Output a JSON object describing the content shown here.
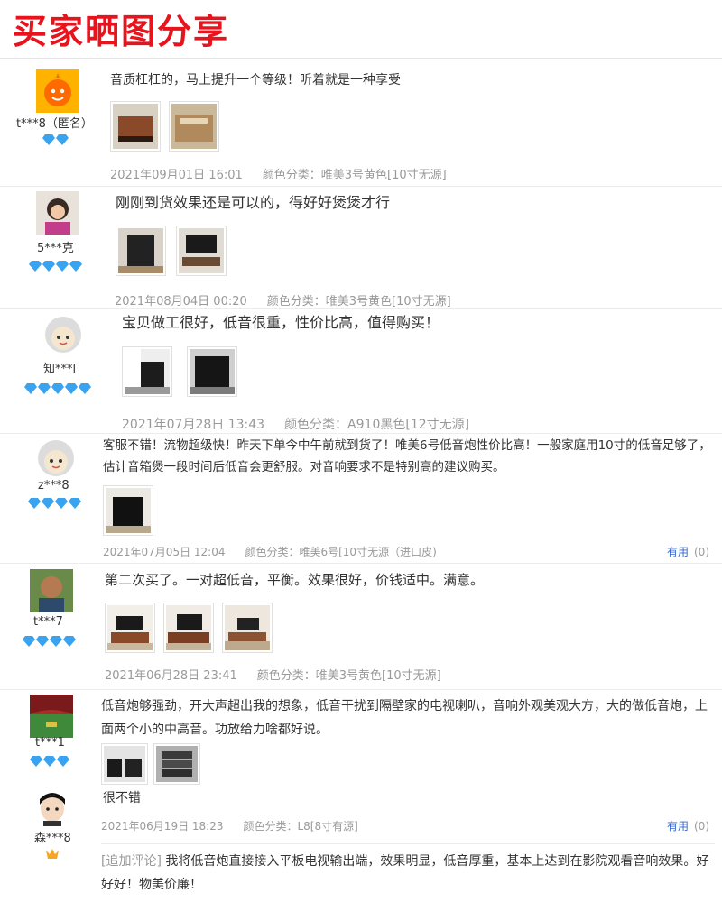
{
  "page_title": "买家晒图分享",
  "useful_label": "有用",
  "reviews": [
    {
      "user": "t***8（匿名）",
      "level": 2,
      "text": "音质杠杠的，马上提升一个等级！听着就是一种享受",
      "date": "2021年09月01日 16:01",
      "spec": "颜色分类：唯美3号黄色[10寸无源]",
      "avatar": "orange-cartoon",
      "images": [
        "brown-speaker-box",
        "packaged-box"
      ]
    },
    {
      "user": "5***克",
      "level": 4,
      "text": "刚刚到货效果还是可以的，得好好煲煲才行",
      "date": "2021年08月04日 00:20",
      "spec": "颜色分类：唯美3号黄色[10寸无源]",
      "avatar": "woman-photo",
      "images": [
        "speaker-on-floor",
        "tv-cabinet"
      ]
    },
    {
      "user": "知***l",
      "level": 5,
      "text": "宝贝做工很好，低音很重，性价比高，值得购买！",
      "date": "2021年07月28日 13:43",
      "spec": "颜色分类：A910黑色[12寸无源]",
      "avatar": "default-cartoon",
      "images": [
        "black-speaker-corner",
        "black-speaker-closeup"
      ]
    },
    {
      "user": "z***8",
      "level": 4,
      "text": "客服不错！流物超级快！昨天下单今中午前就到货了！唯美6号低音炮性价比高！一般家庭用10寸的低音足够了，估计音箱煲一段时间后低音会更舒服。对音响要求不是特别高的建议购买。",
      "date": "2021年07月05日 12:04",
      "spec": "颜色分类：唯美6号[10寸无源（进口皮)",
      "avatar": "default-cartoon",
      "images": [
        "black-speaker"
      ],
      "useful_count": "(0)"
    },
    {
      "user": "t***7",
      "level": 4,
      "text": "第二次买了。一对超低音，平衡。效果很好，价钱适中。满意。",
      "date": "2021年06月28日 23:41",
      "spec": "颜色分类：唯美3号黄色[10寸无源]",
      "avatar": "man-photo",
      "images": [
        "living-room-1",
        "living-room-2",
        "living-room-3"
      ]
    },
    {
      "user": "t***1",
      "level": 3,
      "text": "低音炮够强劲，开大声超出我的想象，低音干扰到隔壁家的电视喇叭，音响外观美观大方，大的做低音炮，上面两个小的中高音。功放给力啥都好说。",
      "date": "",
      "spec": "",
      "avatar": "stadium-photo",
      "images": [
        "speakers-small",
        "amplifier-stack"
      ]
    },
    {
      "user": "森***8",
      "level": 0,
      "crown": true,
      "text": "很不错",
      "date": "2021年06月19日 18:23",
      "spec": "颜色分类：L8[8寸有源]",
      "avatar": "boy-cartoon",
      "images": [],
      "useful_count": "(0)",
      "followup_tag": "[追加评论]",
      "followup_text": "我将低音炮直接接入平板电视输出端，效果明显，低音厚重，基本上达到在影院观看音响效果。好好好！物美价廉！"
    }
  ],
  "colors": {
    "title_red": "#e8141d",
    "diamond": "#3aa3f0",
    "link": "#3366cc",
    "meta": "#999999"
  }
}
